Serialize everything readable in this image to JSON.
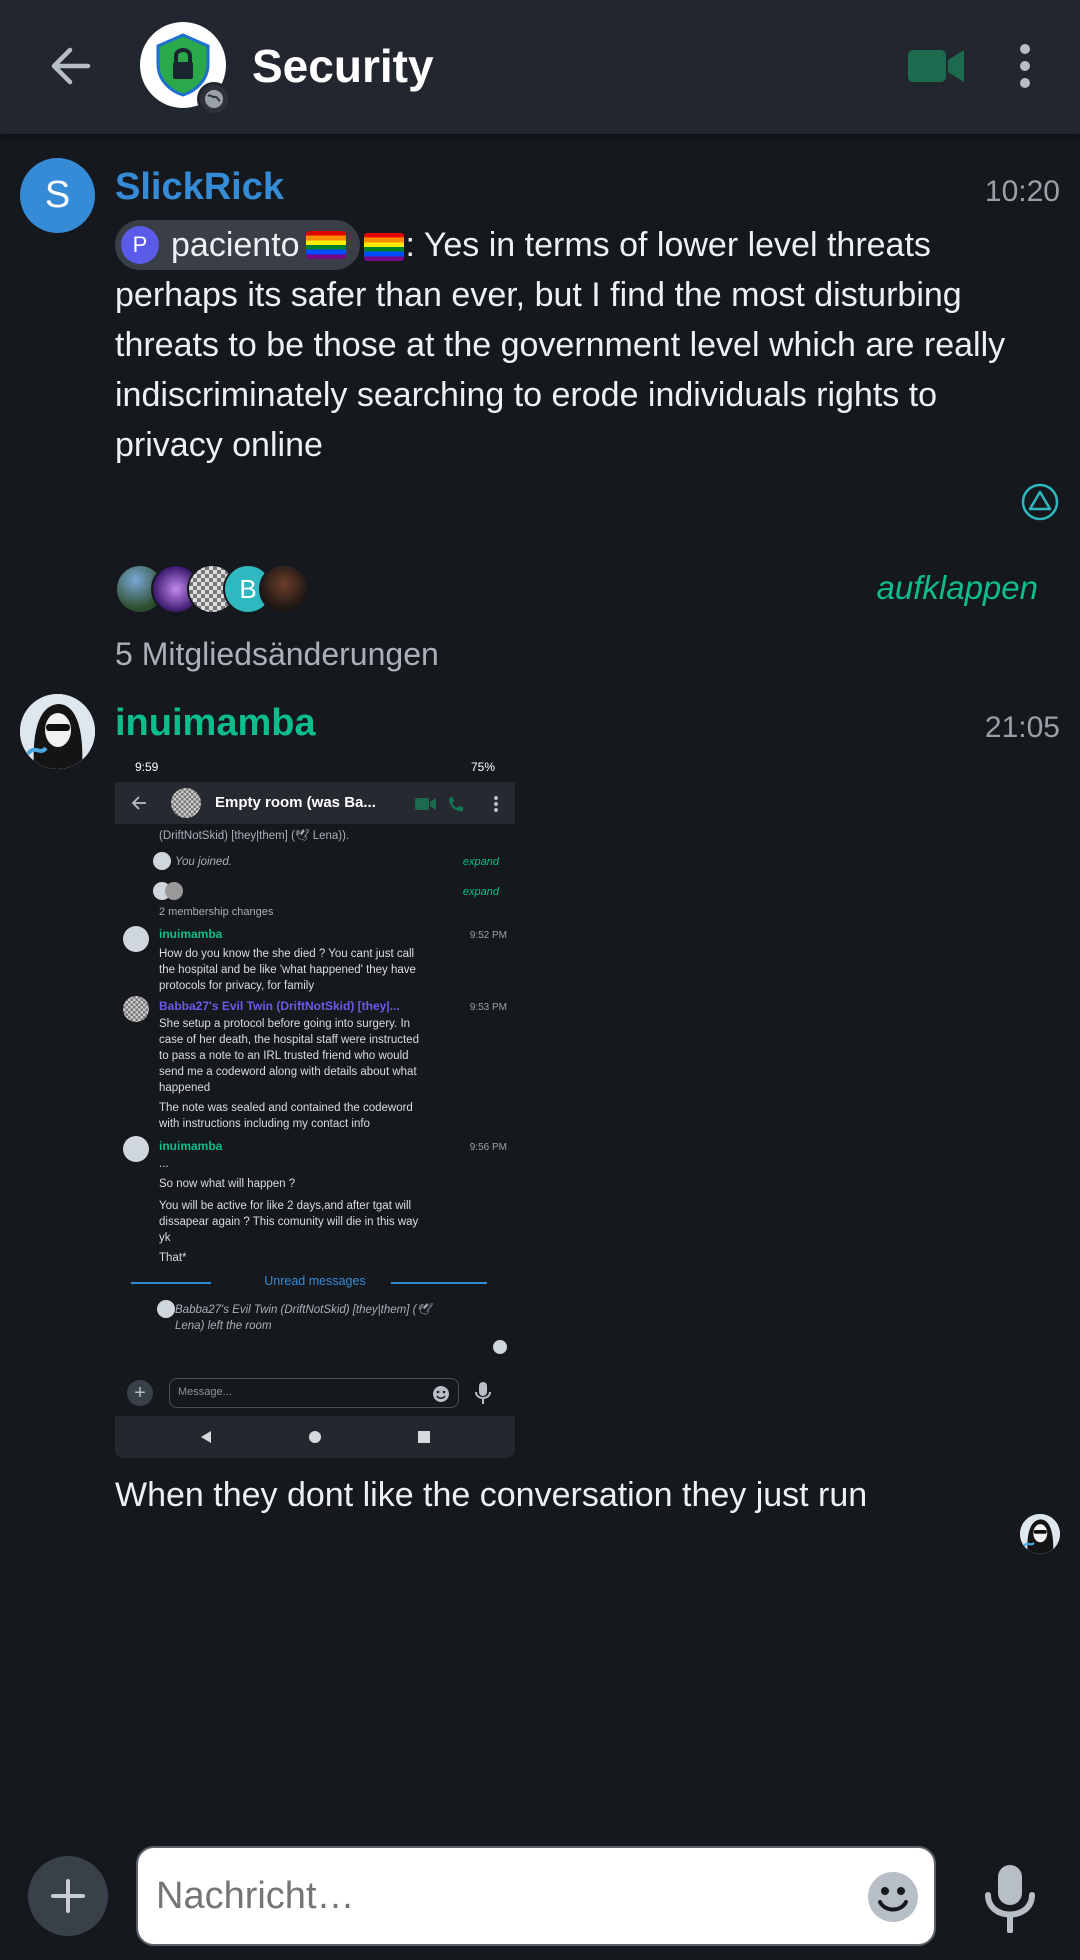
{
  "header": {
    "title": "Security",
    "colors": {
      "background": "#22262e",
      "accent": "#0dbd8b",
      "video_icon": "#1c6b4f"
    }
  },
  "timeline": {
    "message_1": {
      "avatar_letter": "S",
      "sender": "SlickRick",
      "time": "10:20",
      "pill_avatar_letter": "P",
      "pill_name": "paciento",
      "text": ": Yes in terms of lower level threats perhaps its safer than ever, but I find the most disturbing threats to be those at the government level which are really indiscriminately searching to erode individuals rights to privacy online"
    },
    "membership": {
      "avatar_letter": "B",
      "expand_label": "aufklappen",
      "summary": "5 Mitgliedsänderungen"
    },
    "message_2": {
      "sender": "inuimamba",
      "time": "21:05",
      "text": "When they dont like the conversation they just run",
      "screenshot": {
        "status_time": "9:59",
        "status_right": "75%",
        "room_title": "Empty room (was Ba...",
        "line_top": "(DriftNotSkid) [they|them] (🕊 Lena)).",
        "you_joined": "You joined.",
        "expand_1": "expand",
        "expand_2": "expand",
        "membership": "2 membership changes",
        "m1_sender": "inuimamba",
        "m1_time": "9:52 PM",
        "m1_lines": [
          "How do you know the she died ? You cant just call",
          "the hospital and be like 'what happened' they have",
          "protocols for privacy, for family"
        ],
        "m2_sender": "Babba27's Evil Twin (DriftNotSkid) [they|...",
        "m2_time": "9:53 PM",
        "m2_lines": [
          "She setup a protocol before going into surgery. In",
          "case of her death, the hospital staff were instructed",
          "to pass a note to an IRL trusted friend who would",
          "send me a codeword along with details about what",
          "happened"
        ],
        "m2_lines_b": [
          "The note was sealed and contained the codeword",
          "with instructions including my contact info"
        ],
        "m3_sender": "inuimamba",
        "m3_time": "9:56 PM",
        "m3_lines": [
          "...",
          "So now what will happen ?",
          "You will be active for like 2 days,and after tgat will",
          "dissapear again ? This comunity will die in this way",
          "yk",
          "That*"
        ],
        "unread": "Unread messages",
        "left_room": [
          "Babba27's Evil Twin (DriftNotSkid) [they|them] (🕊",
          "Lena) left the room"
        ],
        "composer_placeholder": "Message..."
      }
    }
  },
  "composer": {
    "placeholder": "Nachricht…"
  }
}
